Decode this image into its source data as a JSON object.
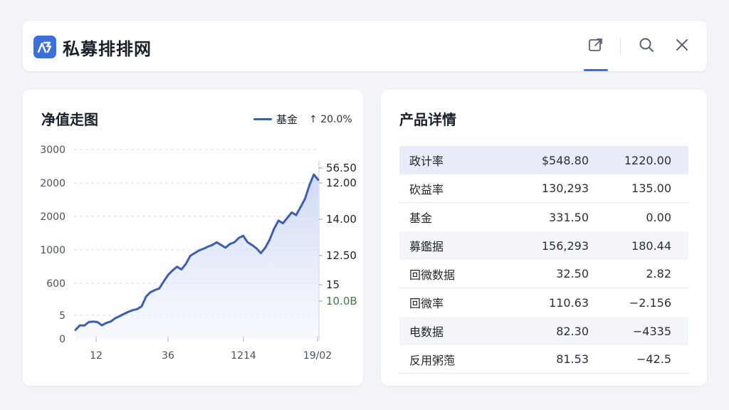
{
  "app": {
    "title": "私募排排网",
    "logo_icon": "fund-logo-icon",
    "actions": [
      {
        "name": "share",
        "icon": "external-link-icon"
      },
      {
        "name": "search",
        "icon": "search-icon"
      },
      {
        "name": "close",
        "icon": "close-icon"
      }
    ]
  },
  "chart_card": {
    "title": "净值走图",
    "legend_label": "基金",
    "legend_change": "↑ 20.0%",
    "accent": "#3d5fae",
    "secondary_accent": "#3a7d44"
  },
  "chart_data": {
    "type": "area",
    "title": "",
    "xlabel": "",
    "ylabel": "",
    "left_ticks": [
      "3000",
      "2000",
      "2000",
      "1000",
      "600",
      "5",
      "0"
    ],
    "right_ticks": [
      "56.50",
      "12.00",
      "14.00",
      "12.50",
      "15",
      "10.0B"
    ],
    "x_ticks": [
      "12",
      "36",
      "1214",
      "19/02"
    ],
    "grid": true,
    "legend_position": "top-right",
    "series": [
      {
        "name": "基金",
        "values": [
          85,
          170,
          165,
          230,
          240,
          230,
          170,
          215,
          240,
          300,
          340,
          380,
          420,
          450,
          470,
          520,
          700,
          780,
          820,
          850,
          980,
          1100,
          1180,
          1250,
          1200,
          1300,
          1450,
          1500,
          1550,
          1580,
          1620,
          1650,
          1700,
          1650,
          1600,
          1670,
          1700,
          1780,
          1820,
          1700,
          1650,
          1590,
          1500,
          1600,
          1750,
          1950,
          2100,
          2050,
          2150,
          2250,
          2200,
          2350,
          2500,
          2750,
          2950,
          2850
        ]
      }
    ]
  },
  "detail_card": {
    "title": "产品详情",
    "rows": [
      {
        "label": "政计率",
        "col1": "$548.80",
        "col2": "1220.00"
      },
      {
        "label": "砍益率",
        "col1": "130,293",
        "col2": "135.00"
      },
      {
        "label": "基金",
        "col1": "331.50",
        "col2": "0.00"
      },
      {
        "label": "募鑑据",
        "col1": "156,293",
        "col2": "180.44"
      },
      {
        "label": "回微数据",
        "col1": "32.50",
        "col2": "2.82"
      },
      {
        "label": "回微率",
        "col1": "110.63",
        "col2": "−2.156"
      },
      {
        "label": "电数据",
        "col1": "82.30",
        "col2": "−4335"
      },
      {
        "label": "反用粥萢",
        "col1": "81.53",
        "col2": "−42.5"
      }
    ]
  }
}
